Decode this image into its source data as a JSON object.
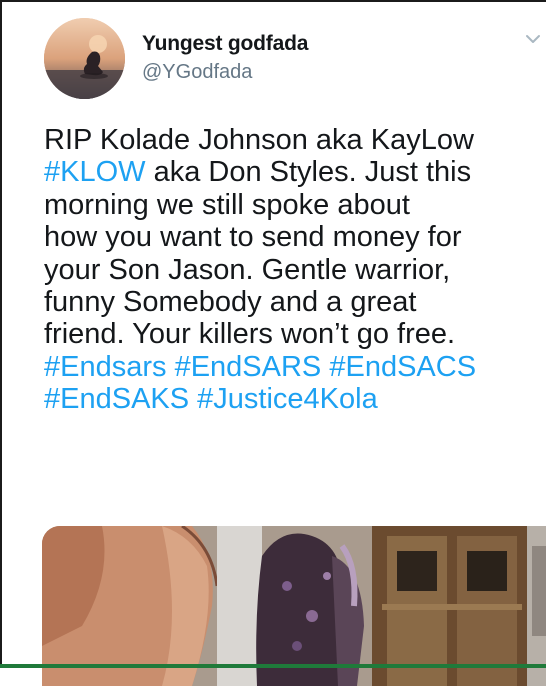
{
  "tweet": {
    "author_name": "Yungest godfada",
    "author_handle": "@YGodfada",
    "menu_icon": "chevron-down-icon",
    "lines": [
      [
        {
          "t": "RIP Kolade Johnson aka KayLow",
          "h": false
        }
      ],
      [
        {
          "t": "#KLOW",
          "h": true
        },
        {
          "t": " aka Don Styles. Just this",
          "h": false
        }
      ],
      [
        {
          "t": "morning we still spoke about",
          "h": false
        }
      ],
      [
        {
          "t": "how you want to send money for",
          "h": false
        }
      ],
      [
        {
          "t": "your Son Jason. Gentle warrior,",
          "h": false
        }
      ],
      [
        {
          "t": "funny Somebody and a great",
          "h": false
        }
      ],
      [
        {
          "t": "friend. Your killers won’t go free.",
          "h": false
        }
      ],
      [
        {
          "t": "#Endsars",
          "h": true
        },
        {
          "t": " ",
          "h": false
        },
        {
          "t": "#EndSARS",
          "h": true
        },
        {
          "t": " ",
          "h": false
        },
        {
          "t": "#EndSACS",
          "h": true
        }
      ],
      [
        {
          "t": "#EndSAKS",
          "h": true
        },
        {
          "t": "  ",
          "h": false
        },
        {
          "t": "#Justice4Kola",
          "h": true
        }
      ]
    ]
  },
  "colors": {
    "hashtag": "#1da1f2",
    "text": "#14171a",
    "handle": "#657786"
  }
}
